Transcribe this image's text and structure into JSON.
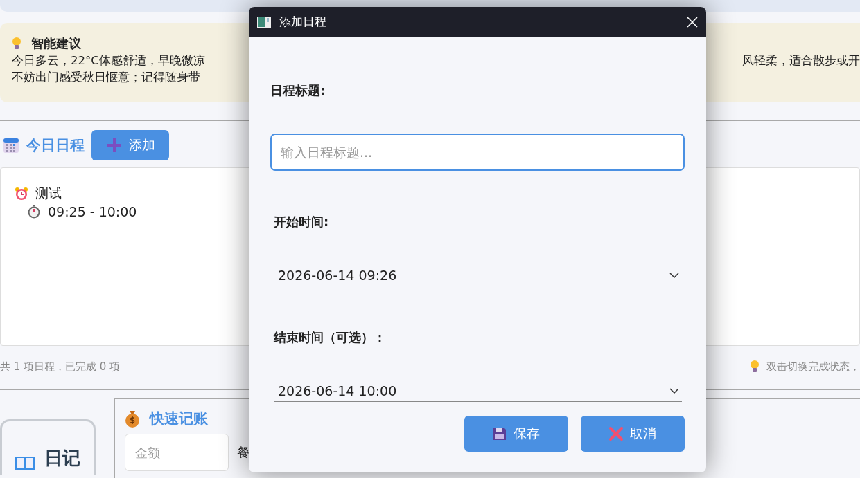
{
  "suggestion": {
    "title": "智能建议",
    "text_left": [
      "今日多云，22°C体感舒适，早晚微凉",
      "不妨出门感受秋日惬意；记得随身带"
    ],
    "text_right": [
      "风轻柔，适合散步或开"
    ]
  },
  "schedule": {
    "title": "今日日程",
    "add_button": "添加",
    "items": [
      {
        "title": "测试",
        "time": "09:25 - 10:00"
      }
    ],
    "summary": "共 1 项日程，已完成 0 项",
    "hint": "双击切换完成状态，"
  },
  "diary_tab": {
    "label": "日记"
  },
  "ledger": {
    "title": "快速记账",
    "amount_placeholder": "金额",
    "category": "餐"
  },
  "dialog": {
    "title": "添加日程",
    "fields": [
      {
        "kind": "text",
        "label": "日程标题:",
        "placeholder": "输入日程标题..."
      },
      {
        "kind": "datetime",
        "label": "开始时间:",
        "value": "2026-06-14 09:26"
      },
      {
        "kind": "datetime",
        "label": "结束时间（可选）：",
        "value": "2026-06-14 10:00"
      }
    ],
    "buttons": [
      {
        "kind": "save",
        "label": "保存"
      },
      {
        "kind": "cancel",
        "label": "取消"
      }
    ]
  }
}
